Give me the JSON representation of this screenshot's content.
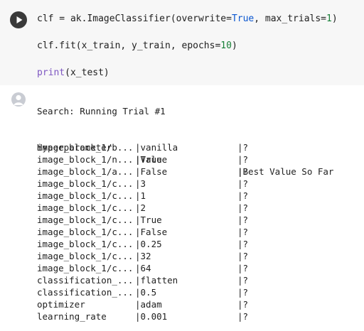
{
  "code_cell": {
    "line1_parts": [
      "clf = ak.ImageClassifier(overwrite=",
      "True",
      ", max_trials=",
      "1",
      ")"
    ],
    "line2_parts": [
      "clf.fit(x_train, y_train, epochs=",
      "10",
      ")"
    ],
    "line3_parts": [
      "print",
      "(x_test)"
    ]
  },
  "output": {
    "status": "Search: Running Trial #1",
    "headers": [
      "Hyperparameter",
      "|Value",
      "|Best Value So Far"
    ],
    "rows": [
      [
        "image_block_1/b...",
        "|vanilla",
        "|?"
      ],
      [
        "image_block_1/n...",
        "|True",
        "|?"
      ],
      [
        "image_block_1/a...",
        "|False",
        "|?"
      ],
      [
        "image_block_1/c...",
        "|3",
        "|?"
      ],
      [
        "image_block_1/c...",
        "|1",
        "|?"
      ],
      [
        "image_block_1/c...",
        "|2",
        "|?"
      ],
      [
        "image_block_1/c...",
        "|True",
        "|?"
      ],
      [
        "image_block_1/c...",
        "|False",
        "|?"
      ],
      [
        "image_block_1/c...",
        "|0.25",
        "|?"
      ],
      [
        "image_block_1/c...",
        "|32",
        "|?"
      ],
      [
        "image_block_1/c...",
        "|64",
        "|?"
      ],
      [
        "classification_...",
        "|flatten",
        "|?"
      ],
      [
        "classification_...",
        "|0.5",
        "|?"
      ],
      [
        "optimizer",
        "|adam",
        "|?"
      ],
      [
        "learning_rate",
        "|0.001",
        "|?"
      ]
    ]
  },
  "icons": {
    "run": "play-icon",
    "output_avatar": "user-avatar-icon"
  }
}
